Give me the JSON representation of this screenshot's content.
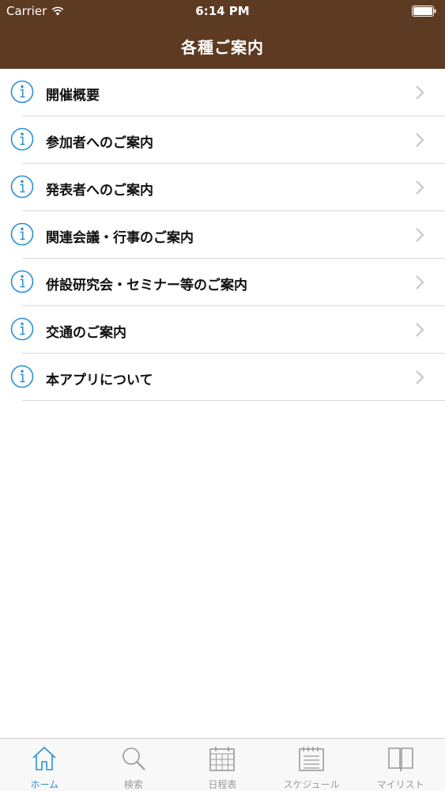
{
  "status_bar": {
    "carrier": "Carrier",
    "time": "6:14 PM"
  },
  "header": {
    "title": "各種ご案内"
  },
  "colors": {
    "header_bg": "#5d3a22",
    "accent": "#2a8fd6",
    "inactive": "#9a9a9a"
  },
  "menu": {
    "items": [
      {
        "label": "開催概要",
        "icon": "info-icon"
      },
      {
        "label": "参加者へのご案内",
        "icon": "info-icon"
      },
      {
        "label": "発表者へのご案内",
        "icon": "info-icon"
      },
      {
        "label": "関連会議・行事のご案内",
        "icon": "info-icon"
      },
      {
        "label": "併設研究会・セミナー等のご案内",
        "icon": "info-icon"
      },
      {
        "label": "交通のご案内",
        "icon": "info-icon"
      },
      {
        "label": "本アプリについて",
        "icon": "info-icon"
      }
    ]
  },
  "tab_bar": {
    "active": "ホーム",
    "tabs": [
      {
        "label": "ホーム",
        "icon": "home-icon"
      },
      {
        "label": "検索",
        "icon": "search-icon"
      },
      {
        "label": "日程表",
        "icon": "calendar-icon"
      },
      {
        "label": "スケジュール",
        "icon": "schedule-icon"
      },
      {
        "label": "マイリスト",
        "icon": "book-icon"
      }
    ]
  }
}
